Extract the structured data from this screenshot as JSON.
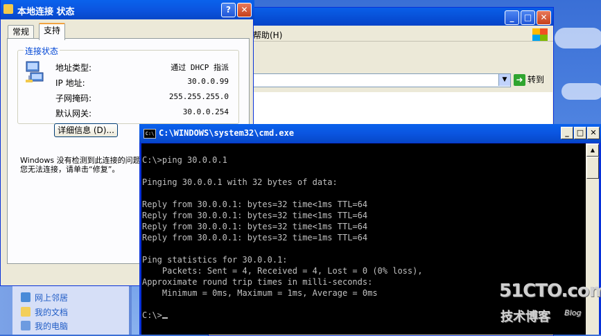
{
  "explorer": {
    "menu_help": "帮助(H)",
    "go_label": "转到",
    "tasks": [
      {
        "label": "网上邻居",
        "icon": "network-places-icon"
      },
      {
        "label": "我的文档",
        "icon": "folder-icon"
      },
      {
        "label": "我的电脑",
        "icon": "computer-icon"
      }
    ]
  },
  "dialog": {
    "title": "本地连接 状态",
    "help_btn": "?",
    "close_btn": "✕",
    "tabs": [
      "常规",
      "支持"
    ],
    "active_tab": "支持",
    "group_title": "连接状态",
    "rows": [
      {
        "label": "地址类型:",
        "value": "通过 DHCP 指派"
      },
      {
        "label": "IP 地址:",
        "value": "30.0.0.99"
      },
      {
        "label": "子网掩码:",
        "value": "255.255.255.0"
      },
      {
        "label": "默认网关:",
        "value": "30.0.0.254"
      }
    ],
    "details_button": "详细信息 (D)...",
    "note_line1": "Windows 没有检测到此连接的问题",
    "note_line2": "您无法连接，请单击“修复”。"
  },
  "cmd": {
    "title": "C:\\WINDOWS\\system32\\cmd.exe",
    "icon_text": "C:\\",
    "lines": [
      "C:\\>ping 30.0.0.1",
      "",
      "Pinging 30.0.0.1 with 32 bytes of data:",
      "",
      "Reply from 30.0.0.1: bytes=32 time<1ms TTL=64",
      "Reply from 30.0.0.1: bytes=32 time<1ms TTL=64",
      "Reply from 30.0.0.1: bytes=32 time<1ms TTL=64",
      "Reply from 30.0.0.1: bytes=32 time=1ms TTL=64",
      "",
      "Ping statistics for 30.0.0.1:",
      "    Packets: Sent = 4, Received = 4, Lost = 0 (0% loss),",
      "Approximate round trip times in milli-seconds:",
      "    Minimum = 0ms, Maximum = 1ms, Average = 0ms",
      "",
      "C:\\>"
    ]
  },
  "watermark": {
    "site": "51CTO.com",
    "sub": "技术博客",
    "blog": "Blog"
  }
}
